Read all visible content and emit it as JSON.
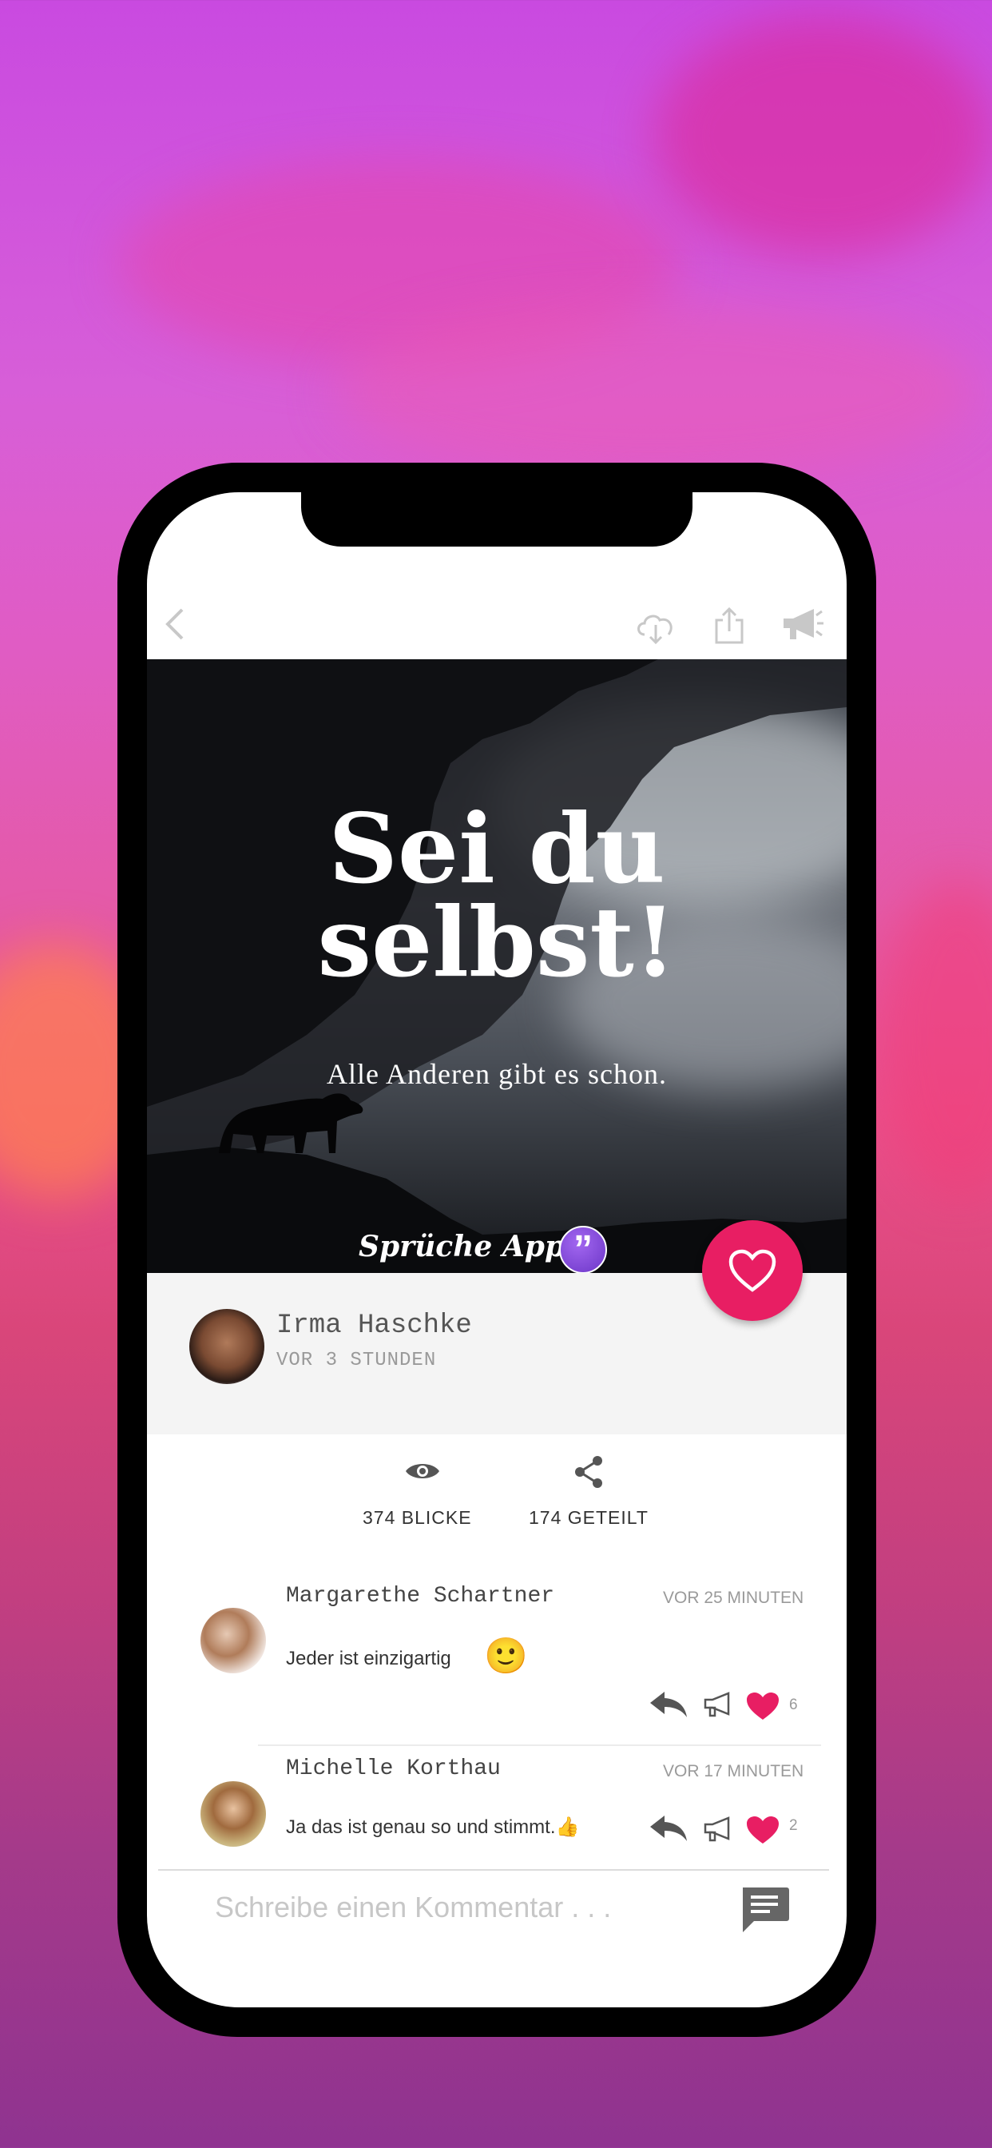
{
  "colors": {
    "accent": "#e81e63",
    "icon_gray": "#666666",
    "panel_bg": "#f4f4f4"
  },
  "toolbar": {
    "icons": [
      "back-chevron-icon",
      "cloud-download-icon",
      "share-upload-icon",
      "megaphone-icon"
    ]
  },
  "post": {
    "title_line1": "Sei du",
    "title_line2": "selbst!",
    "subtitle": "Alle Anderen gibt es schon.",
    "brand": "Sprüche App",
    "brand_badge": "”"
  },
  "author": {
    "name": "Irma Haschke",
    "time": "VOR 3 STUNDEN"
  },
  "stats": {
    "views": "374 BLICKE",
    "shares": "174 GETEILT"
  },
  "comments": [
    {
      "name": "Margarethe Schartner",
      "time": "VOR 25 MINUTEN",
      "text": "Jeder ist einzigartig",
      "emoji": "🙂",
      "likes": "6"
    },
    {
      "name": "Michelle Korthau",
      "time": "VOR 17 MINUTEN",
      "text": "Ja das ist genau so und stimmt.👍",
      "likes": "2"
    }
  ],
  "composer": {
    "placeholder": "Schreibe einen Kommentar . . ."
  }
}
